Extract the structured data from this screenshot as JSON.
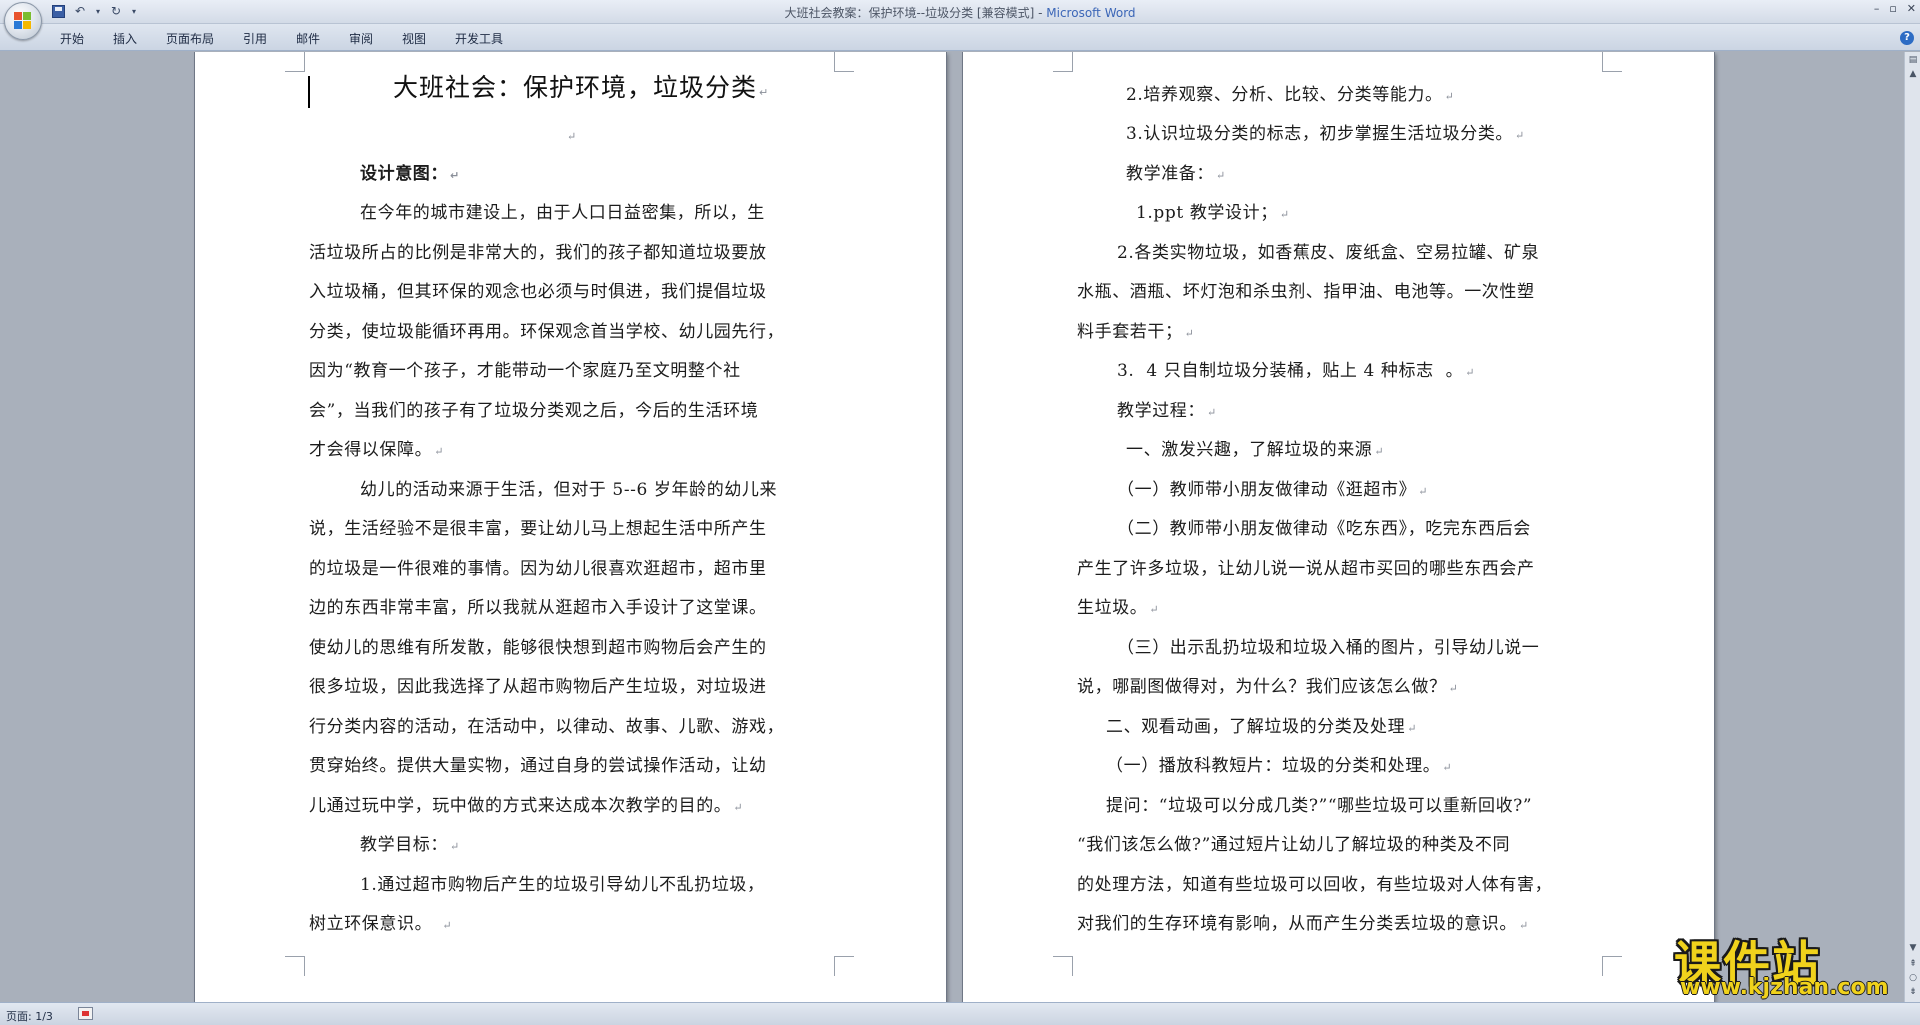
{
  "window": {
    "title_doc": "大班社会教案：保护环境--垃圾分类 [兼容模式] - ",
    "title_app": "Microsoft Word"
  },
  "ribbon": {
    "tabs": [
      "开始",
      "插入",
      "页面布局",
      "引用",
      "邮件",
      "审阅",
      "视图",
      "开发工具"
    ]
  },
  "page1": {
    "title": "大班社会：保护环境，垃圾分类",
    "lines": [
      "设计意图：",
      "在今年的城市建设上，由于人口日益密集，所以，生",
      "活垃圾所占的比例是非常大的，我们的孩子都知道垃圾要放",
      "入垃圾桶，但其环保的观念也必须与时俱进，我们提倡垃圾",
      "分类，使垃圾能循环再用。环保观念首当学校、幼儿园先行，",
      "因为“教育一个孩子，才能带动一个家庭乃至文明整个社",
      "会”，当我们的孩子有了垃圾分类观之后，今后的生活环境",
      "才会得以保障。",
      "幼儿的活动来源于生活，但对于 5--6 岁年龄的幼儿来",
      "说，生活经验不是很丰富，要让幼儿马上想起生活中所产生",
      "的垃圾是一件很难的事情。因为幼儿很喜欢逛超市，超市里",
      "边的东西非常丰富，所以我就从逛超市入手设计了这堂课。",
      "使幼儿的思维有所发散，能够很快想到超市购物后会产生的",
      "很多垃圾，因此我选择了从超市购物后产生垃圾，对垃圾进",
      "行分类内容的活动，在活动中，以律动、故事、儿歌、游戏，",
      "贯穿始终。提供大量实物，通过自身的尝试操作活动，让幼",
      "儿通过玩中学，玩中做的方式来达成本次教学的目的。",
      "教学目标：",
      "1.通过超市购物后产生的垃圾引导幼儿不乱扔垃圾，",
      "树立环保意识。"
    ]
  },
  "page2": {
    "lines": [
      "2.培养观察、分析、比较、分类等能力。",
      "3.认识垃圾分类的标志，初步掌握生活垃圾分类。",
      "教学准备：",
      "1.ppt 教学设计；",
      "2.各类实物垃圾，如香蕉皮、废纸盒、空易拉罐、矿泉",
      "水瓶、酒瓶、坏灯泡和杀虫剂、指甲油、电池等。一次性塑",
      "料手套若干；",
      "3.  4 只自制垃圾分装桶，贴上 4 种标志  。",
      "教学过程：",
      "一、激发兴趣，了解垃圾的来源",
      "（一）教师带小朋友做律动《逛超市》",
      "（二）教师带小朋友做律动《吃东西》，吃完东西后会",
      "产生了许多垃圾，让幼儿说一说从超市买回的哪些东西会产",
      "生垃圾。",
      "（三）出示乱扔垃圾和垃圾入桶的图片，引导幼儿说一",
      "说，哪副图做得对，为什么？我们应该怎么做？",
      "二、观看动画，了解垃圾的分类及处理",
      "（一）播放科教短片：垃圾的分类和处理。",
      "提问：“垃圾可以分成几类?”“哪些垃圾可以重新回收?”",
      "“我们该怎么做?”通过短片让幼儿了解垃圾的种类及不同",
      "的处理方法，知道有些垃圾可以回收，有些垃圾对人体有害，",
      "对我们的生存环境有影响，从而产生分类丢垃圾的意识。"
    ]
  },
  "statusbar": {
    "page": "页面: 1/3"
  },
  "watermark": {
    "cn": "课件站",
    "en": "www.kjzhan.com"
  }
}
